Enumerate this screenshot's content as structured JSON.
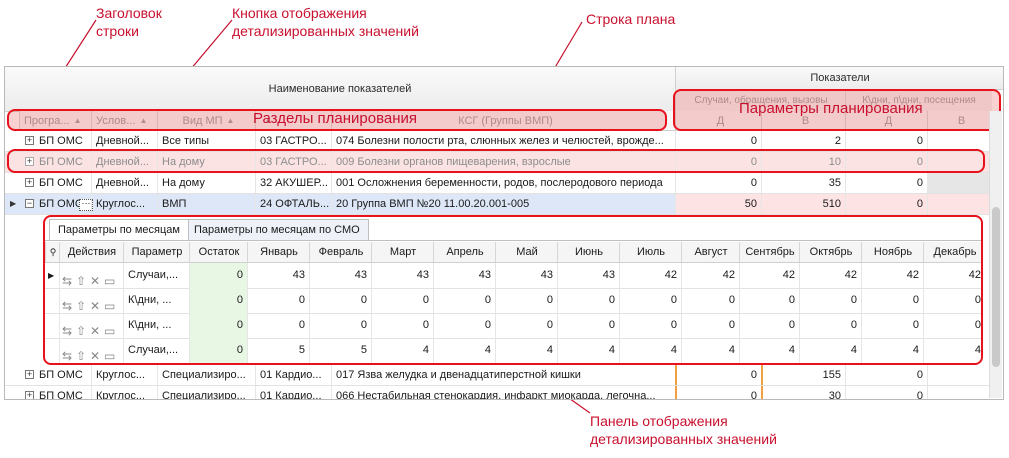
{
  "callouts": {
    "row_header": "Заголовок\nстроки",
    "detail_button": "Кнопка отображения\nдетализированных значений",
    "plan_row": "Строка плана",
    "detail_panel": "Панель отображения\nдетализированных значений",
    "sections": "Разделы планирования",
    "params": "Параметры планирования"
  },
  "grid": {
    "band_names": "Наименование показателей",
    "band_indicators": "Показатели",
    "sub_cases": "Случаи, обращения, вызовы",
    "sub_days": "К\\дни, п\\дни, посещения",
    "columns": {
      "program": "Програ...",
      "conditions": "Услов...",
      "mp_type": "Вид МП",
      "ksg": "КСГ (Группы ВМП)",
      "d1": "Д",
      "v1": "В",
      "d2": "Д",
      "v2": "В"
    },
    "rows": [
      {
        "program": "БП ОМС",
        "cond": "Дневной...",
        "mp": "Все типы",
        "prof": "03 ГАСТРО...",
        "ksg": "074 Болезни полости рта, слюнных желез и челюстей, врожде...",
        "d1": "0",
        "v1": "2",
        "d2": "0"
      },
      {
        "program": "БП ОМС",
        "cond": "Дневной...",
        "mp": "На дому",
        "prof": "03 ГАСТРО...",
        "ksg": "009 Болезни органов пищеварения, взрослые",
        "d1": "0",
        "v1": "10",
        "d2": "0"
      },
      {
        "program": "БП ОМС",
        "cond": "Дневной...",
        "mp": "На дому",
        "prof": "32 АКУШЕР...",
        "ksg": "001 Осложнения беременности, родов, послеродового периода",
        "d1": "0",
        "v1": "35",
        "d2": "0"
      },
      {
        "program": "БП ОМС",
        "cond": "Круглос...",
        "mp": "ВМП",
        "prof": "24 ОФТАЛЬ...",
        "ksg": "20 Группа ВМП №20 11.00.20.001-005",
        "d1": "50",
        "v1": "510",
        "d2": "0"
      },
      {
        "program": "БП ОМС",
        "cond": "Круглос...",
        "mp": "Специализиро...",
        "prof": "01 Кардио...",
        "ksg": "017 Язва желудка и двенадцатиперстной кишки",
        "d1": "0",
        "v1": "155",
        "d2": "0"
      },
      {
        "program": "БП ОМС",
        "cond": "Круглос...",
        "mp": "Специализиро...",
        "prof": "01 Кардио...",
        "ksg": "066 Нестабильная стенокардия, инфаркт миокарда, легочна...",
        "d1": "0",
        "v1": "30",
        "d2": "0"
      }
    ]
  },
  "detail": {
    "tabs": [
      "Параметры по месяцам",
      "Параметры по месяцам по СМО"
    ],
    "headers": [
      "Действия",
      "Параметр",
      "Остаток",
      "Январь",
      "Февраль",
      "Март",
      "Апрель",
      "Май",
      "Июнь",
      "Июль",
      "Август",
      "Сентябрь",
      "Октябрь",
      "Ноябрь",
      "Декабрь"
    ],
    "rows": [
      {
        "param": "Случаи,...",
        "values": [
          "0",
          "43",
          "43",
          "43",
          "43",
          "43",
          "43",
          "42",
          "42",
          "42",
          "42",
          "42",
          "42"
        ]
      },
      {
        "param": "К\\дни, ...",
        "values": [
          "0",
          "0",
          "0",
          "0",
          "0",
          "0",
          "0",
          "0",
          "0",
          "0",
          "0",
          "0",
          "0"
        ]
      },
      {
        "param": "К\\дни, ...",
        "values": [
          "0",
          "0",
          "0",
          "0",
          "0",
          "0",
          "0",
          "0",
          "0",
          "0",
          "0",
          "0",
          "0"
        ]
      },
      {
        "param": "Случаи,...",
        "values": [
          "0",
          "5",
          "5",
          "4",
          "4",
          "4",
          "4",
          "4",
          "4",
          "4",
          "4",
          "4",
          "4"
        ]
      }
    ]
  }
}
